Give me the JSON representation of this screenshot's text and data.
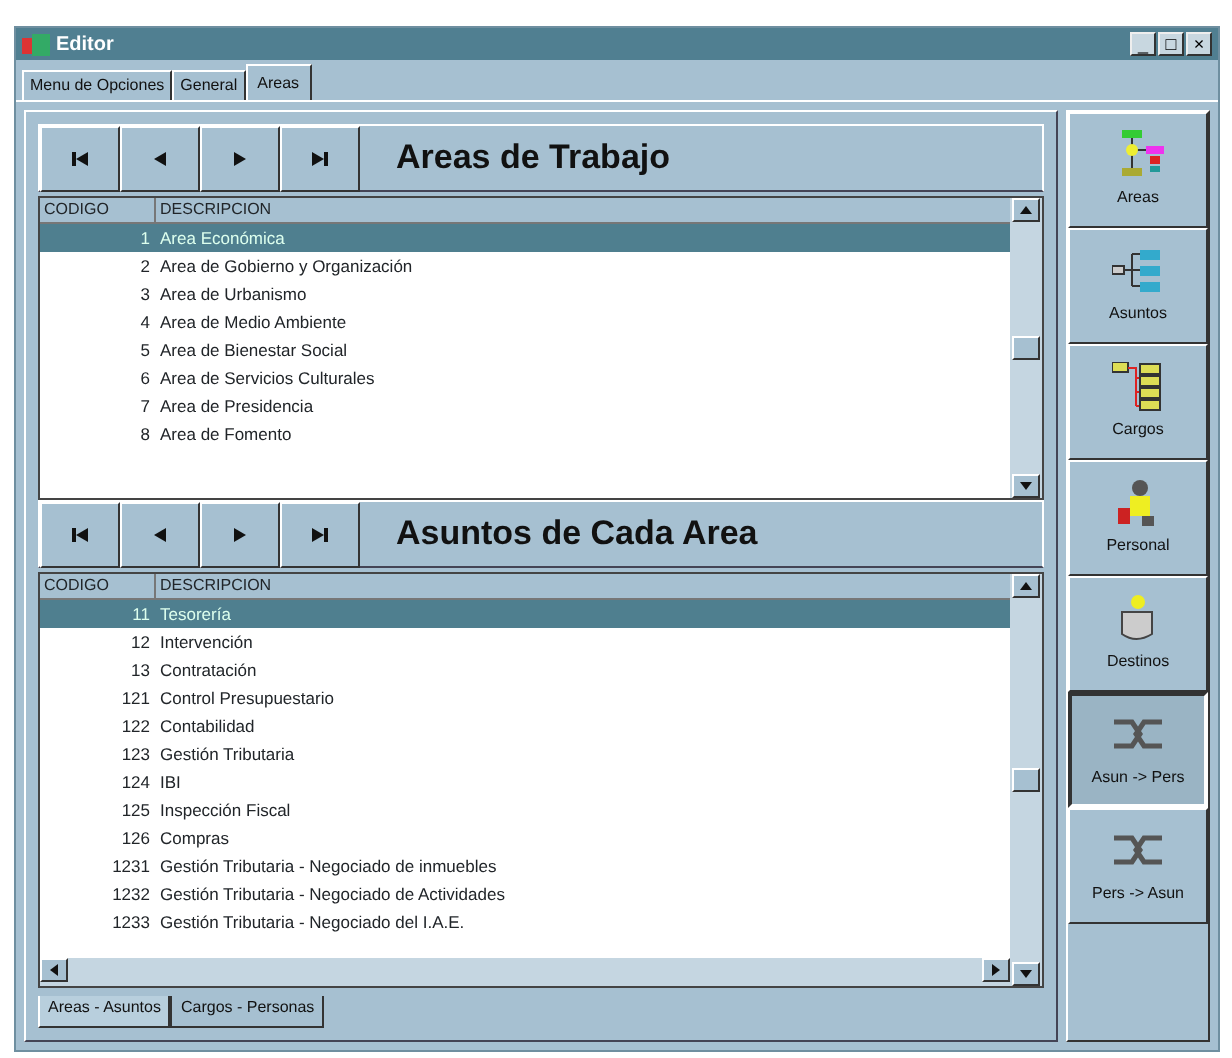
{
  "window": {
    "title": "Editor",
    "controls": [
      "_",
      "□",
      "×"
    ]
  },
  "tabs": [
    {
      "label": "Menu de Opciones",
      "selected": false
    },
    {
      "label": "General",
      "selected": false
    },
    {
      "label": "Areas",
      "selected": true
    }
  ],
  "sections": [
    {
      "title": "Areas de Trabajo",
      "columns": [
        "CODIGO",
        "DESCRIPCION"
      ],
      "hscroll": false,
      "rows": [
        {
          "code": "1",
          "description": "Area Económica",
          "selected": true
        },
        {
          "code": "2",
          "description": "Area de Gobierno y Organización",
          "selected": false
        },
        {
          "code": "3",
          "description": "Area de Urbanismo",
          "selected": false
        },
        {
          "code": "4",
          "description": "Area de Medio Ambiente",
          "selected": false
        },
        {
          "code": "5",
          "description": "Area de Bienestar Social",
          "selected": false
        },
        {
          "code": "6",
          "description": "Area de Servicios Culturales",
          "selected": false
        },
        {
          "code": "7",
          "description": "Area de Presidencia",
          "selected": false
        },
        {
          "code": "8",
          "description": "Area de Fomento",
          "selected": false
        }
      ]
    },
    {
      "title": "Asuntos de Cada Area",
      "columns": [
        "CODIGO",
        "DESCRIPCION"
      ],
      "hscroll": true,
      "rows": [
        {
          "code": "11",
          "description": "Tesorería",
          "selected": true
        },
        {
          "code": "12",
          "description": "Intervención",
          "selected": false
        },
        {
          "code": "13",
          "description": "Contratación",
          "selected": false
        },
        {
          "code": "121",
          "description": "Control Presupuestario",
          "selected": false
        },
        {
          "code": "122",
          "description": "Contabilidad",
          "selected": false
        },
        {
          "code": "123",
          "description": "Gestión Tributaria",
          "selected": false
        },
        {
          "code": "124",
          "description": "IBI",
          "selected": false
        },
        {
          "code": "125",
          "description": "Inspección Fiscal",
          "selected": false
        },
        {
          "code": "126",
          "description": "Compras",
          "selected": false
        },
        {
          "code": "1231",
          "description": "Gestión Tributaria - Negociado de inmuebles",
          "selected": false
        },
        {
          "code": "1232",
          "description": "Gestión Tributaria - Negociado de Actividades",
          "selected": false
        },
        {
          "code": "1233",
          "description": "Gestión Tributaria - Negociado del I.A.E.",
          "selected": false
        }
      ]
    }
  ],
  "bottom_tabs": [
    {
      "label": "Areas - Asuntos",
      "selected": true
    },
    {
      "label": "Cargos - Personas",
      "selected": false
    }
  ],
  "toolbar": [
    {
      "kind": "areas",
      "label": "Areas",
      "pressed": false
    },
    {
      "kind": "asuntos",
      "label": "Asuntos",
      "pressed": false
    },
    {
      "kind": "cargos",
      "label": "Cargos",
      "pressed": false
    },
    {
      "kind": "personal",
      "label": "Personal",
      "pressed": false
    },
    {
      "kind": "destinos",
      "label": "Destinos",
      "pressed": false
    },
    {
      "kind": "link",
      "label": "Asun -> Pers",
      "pressed": true
    },
    {
      "kind": "link",
      "label": "Pers -> Asun",
      "pressed": false
    }
  ]
}
